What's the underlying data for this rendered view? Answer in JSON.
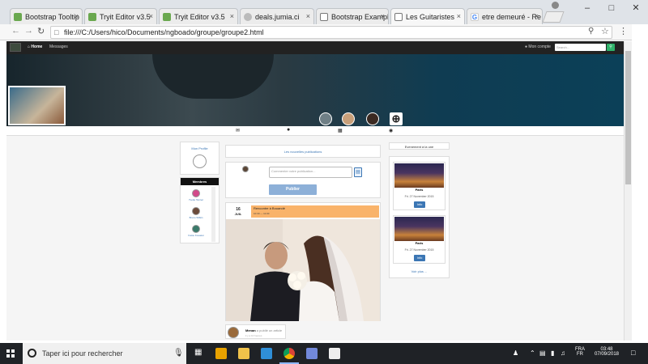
{
  "browser": {
    "tabs": [
      {
        "label": "Bootstrap Tooltip",
        "favicon": "w3schools-icon",
        "active": false
      },
      {
        "label": "Tryit Editor v3.5",
        "favicon": "w3schools-icon",
        "active": false
      },
      {
        "label": "Tryit Editor v3.5",
        "favicon": "w3schools-icon",
        "active": false
      },
      {
        "label": "deals.jumia.ci",
        "favicon": "globe-icon",
        "active": false
      },
      {
        "label": "Bootstrap Example",
        "favicon": "document-icon",
        "active": false
      },
      {
        "label": "Les Guitaristes",
        "favicon": "document-icon",
        "active": true
      },
      {
        "label": "etre demeuré - Re",
        "favicon": "google-icon",
        "active": false
      }
    ],
    "url": "file:///C:/Users/hico/Documents/ngboado/groupe/groupe2.html",
    "close_glyph": "×"
  },
  "navbar": {
    "home": "Home",
    "messages": "Messages",
    "account": "Mon compte",
    "search_placeholder": "Search..."
  },
  "left": {
    "profile_title": "Mon Profile",
    "members_header": "Membres",
    "members": [
      {
        "name": "Yvette Tanner"
      },
      {
        "name": "Bruno Wilkin"
      },
      {
        "name": "Fatou Kouassi"
      }
    ]
  },
  "center": {
    "publications_title": "Les nouvelles publications",
    "comment_placeholder": "Commenter votre publication...",
    "publish_button": "Publier",
    "event": {
      "day": "16",
      "month": "JUIL",
      "title": "Rencontre à Bouandé",
      "time": "10:30 — 11:00"
    },
    "post": {
      "author": "Menan",
      "action": "a publié un article",
      "time": "il y a 10 heures"
    }
  },
  "right": {
    "events_title": "Evenement à la une",
    "events": [
      {
        "city": "Paris",
        "date": "Fri. 27 November 2015",
        "button": "Info"
      },
      {
        "city": "Paris",
        "date": "Fri. 27 November 2015",
        "button": "Info"
      }
    ],
    "more": "Voir plus ..."
  },
  "taskbar": {
    "search_text": "Taper ici pour rechercher",
    "lang_top": "FRA",
    "lang_bottom": "FR",
    "time": "03:48",
    "date": "07/09/2018"
  },
  "colors": {
    "accent_blue": "#3b76b4",
    "event_orange": "#f9b36a",
    "search_button_green": "#2fb36a",
    "navbar": "#222222"
  }
}
